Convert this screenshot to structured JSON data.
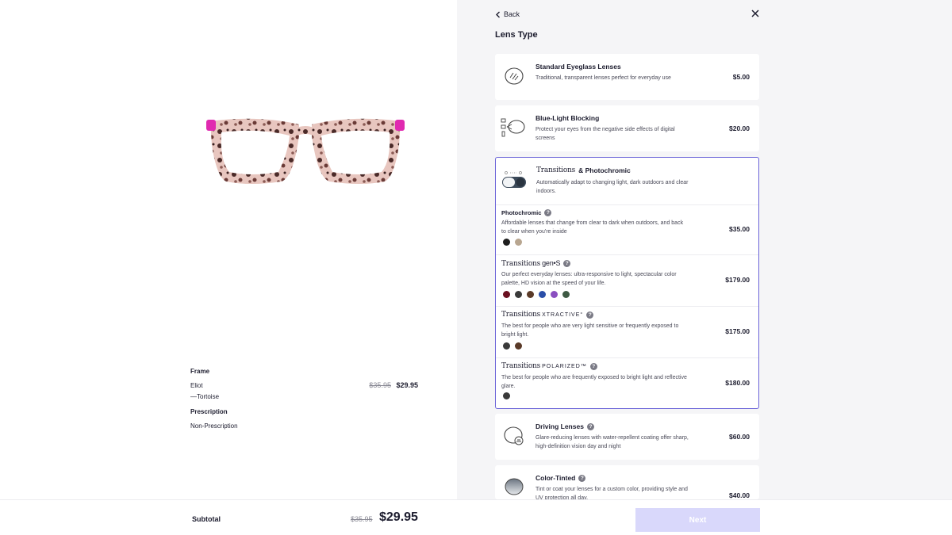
{
  "nav": {
    "back_label": "Back"
  },
  "lens_section": {
    "title": "Lens Type"
  },
  "options": {
    "standard": {
      "title": "Standard Eyeglass Lenses",
      "description": "Traditional, transparent lenses perfect for everyday use",
      "price": "$5.00"
    },
    "blue_light": {
      "title": "Blue-Light Blocking",
      "description": "Protect your eyes from the negative side effects of digital screens",
      "price": "$20.00"
    },
    "transitions": {
      "brand": "Transitions",
      "title_suffix": "& Photochromic",
      "description": "Automatically adapt to changing light, dark outdoors and clear indoors.",
      "accent_color": "#6a63d8",
      "sub": [
        {
          "title": "Photochromic",
          "description": "Affordable lenses that change from clear to dark when outdoors, and back to clear when you're inside",
          "price": "$35.00",
          "swatches": [
            "#1e1e1e",
            "#b8a690"
          ]
        },
        {
          "brand": "Transitions",
          "product": "gen•S",
          "description": "Our perfect everyday lenses: ultra-responsive to light, spectacular color palette, HD vision at the speed of your life.",
          "price": "$179.00",
          "swatches": [
            "#6b1020",
            "#3a3a3a",
            "#5a3a28",
            "#2a4ea8",
            "#8a4fc0",
            "#3e5a44"
          ]
        },
        {
          "brand": "Transitions",
          "product": "XTRACTIVE°",
          "description": "The best for people who are very light sensitive or frequently exposed to bright light.",
          "price": "$175.00",
          "swatches": [
            "#3a3a3a",
            "#5a3a28"
          ]
        },
        {
          "brand": "Transitions",
          "product": "POLARIZED™",
          "description": "The best for people who are frequently exposed to bright light and reflective glare.",
          "price": "$180.00",
          "swatches": [
            "#3a3a3a"
          ]
        }
      ]
    },
    "driving": {
      "title": "Driving Lenses",
      "description": "Glare-reducing lenses with water-repellent coating offer sharp, high-definition vision day and night",
      "price": "$60.00"
    },
    "tinted": {
      "title": "Color-Tinted",
      "description": "Tint or coat your lenses for a custom color, providing style and UV protection all day.",
      "price": "$40.00"
    }
  },
  "frame": {
    "label": "Frame",
    "name": "Eliot",
    "color": "—Tortoise",
    "price_old": "$35.95",
    "price_new": "$29.95",
    "prescription_label": "Prescription",
    "prescription_value": "Non-Prescription"
  },
  "footer": {
    "subtotal_label": "Subtotal",
    "subtotal_old": "$35.95",
    "subtotal_new": "$29.95",
    "next_label": "Next",
    "next_color": "#d9d8fb"
  },
  "help_glyph": "?"
}
